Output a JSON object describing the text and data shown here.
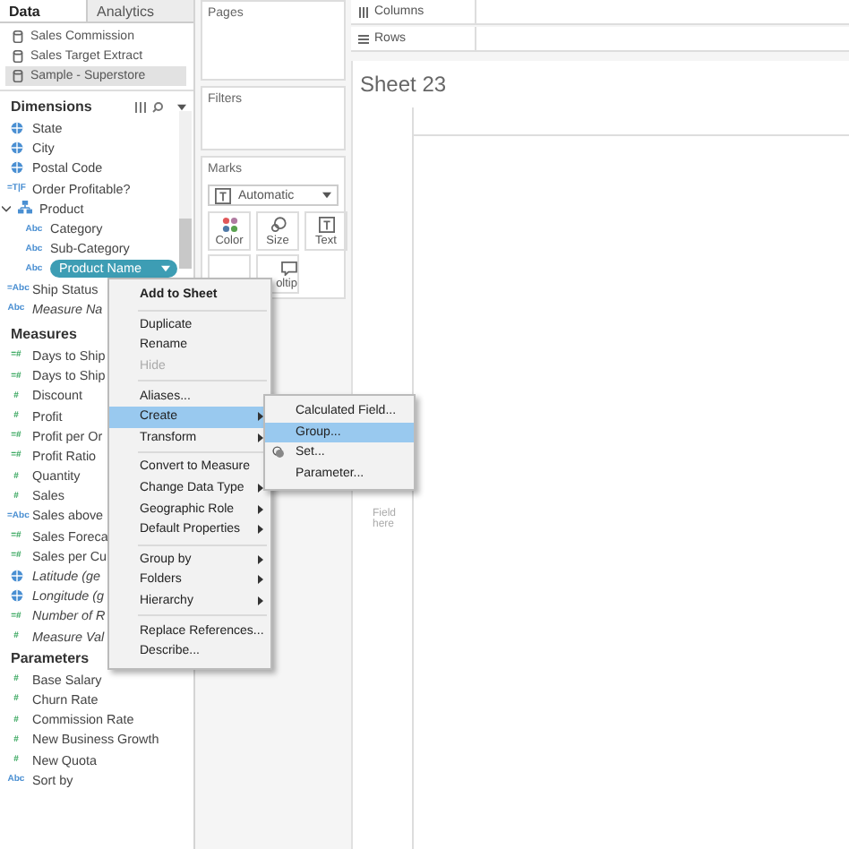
{
  "tabs": [
    {
      "label": "Data",
      "selected": true
    },
    {
      "label": "Analytics",
      "selected": false
    }
  ],
  "data_sources": [
    {
      "label": "Sales Commission",
      "selected": false
    },
    {
      "label": "Sales Target Extract",
      "selected": false
    },
    {
      "label": "Sample - Superstore",
      "selected": true
    }
  ],
  "dimensions": {
    "title": "Dimensions",
    "items": [
      {
        "label": "State",
        "kind": "geo",
        "italic": false,
        "selected": false
      },
      {
        "label": "City",
        "kind": "geo",
        "italic": false,
        "selected": false
      },
      {
        "label": "Postal Code",
        "kind": "geo",
        "italic": false,
        "selected": false
      },
      {
        "label": "Order Profitable?",
        "kind": "dimension",
        "glyph": "=T|F",
        "italic": false,
        "selected": false
      },
      {
        "label": "Product",
        "kind": "hierarchy",
        "italic": false,
        "selected": false,
        "expanded": true,
        "children": [
          {
            "label": "Category",
            "kind": "dimension",
            "glyph": "Abc",
            "italic": false,
            "selected": false
          },
          {
            "label": "Sub-Category",
            "kind": "dimension",
            "glyph": "Abc",
            "italic": false,
            "selected": false
          },
          {
            "label": "Product Name",
            "kind": "dimension",
            "glyph": "Abc",
            "selected": true
          }
        ]
      },
      {
        "label": "Ship Status",
        "kind": "dimension",
        "glyph": "=Abc",
        "italic": false,
        "selected": false
      },
      {
        "label": "Measure Na",
        "kind": "dimension",
        "glyph": "Abc",
        "italic": true,
        "selected": false
      }
    ]
  },
  "measures": {
    "title": "Measures",
    "items": [
      {
        "label": "Days to Ship",
        "kind": "measure",
        "glyph": "=#",
        "italic": false
      },
      {
        "label": "Days to Ship",
        "kind": "measure",
        "glyph": "=#",
        "italic": false
      },
      {
        "label": "Discount",
        "kind": "measure",
        "glyph": "#",
        "italic": false
      },
      {
        "label": "Profit",
        "kind": "measure",
        "glyph": "#",
        "italic": false
      },
      {
        "label": "Profit per Or",
        "kind": "measure",
        "glyph": "=#",
        "italic": false
      },
      {
        "label": "Profit Ratio",
        "kind": "measure",
        "glyph": "=#",
        "italic": false
      },
      {
        "label": "Quantity",
        "kind": "measure",
        "glyph": "#",
        "italic": false
      },
      {
        "label": "Sales",
        "kind": "measure",
        "glyph": "#",
        "italic": false
      },
      {
        "label": "Sales above",
        "kind": "dimension",
        "glyph": "=Abc",
        "italic": false
      },
      {
        "label": "Sales Foreca",
        "kind": "measure",
        "glyph": "=#",
        "italic": false
      },
      {
        "label": "Sales per Cu",
        "kind": "measure",
        "glyph": "=#",
        "italic": false
      },
      {
        "label": "Latitude (ge",
        "kind": "geo",
        "italic": true
      },
      {
        "label": "Longitude (g",
        "kind": "geo",
        "italic": true
      },
      {
        "label": "Number of R",
        "kind": "measure",
        "glyph": "=#",
        "italic": true
      },
      {
        "label": "Measure Val",
        "kind": "measure",
        "glyph": "#",
        "italic": true
      }
    ]
  },
  "parameters": {
    "title": "Parameters",
    "items": [
      {
        "label": "Base Salary",
        "kind": "measure",
        "glyph": "#",
        "italic": false
      },
      {
        "label": "Churn Rate",
        "kind": "measure",
        "glyph": "#",
        "italic": false
      },
      {
        "label": "Commission Rate",
        "kind": "measure",
        "glyph": "#",
        "italic": false
      },
      {
        "label": "New Business Growth",
        "kind": "measure",
        "glyph": "#",
        "italic": false
      },
      {
        "label": "New Quota",
        "kind": "measure",
        "glyph": "#",
        "italic": false
      },
      {
        "label": "Sort by",
        "kind": "dimension",
        "glyph": "Abc",
        "italic": false
      }
    ]
  },
  "shelves": {
    "pages": "Pages",
    "filters": "Filters",
    "columns": "Columns",
    "rows": "Rows"
  },
  "marks": {
    "title": "Marks",
    "mark_type": "Automatic",
    "cards": [
      {
        "label": "Color",
        "kind": "color"
      },
      {
        "label": "Size",
        "kind": "size"
      },
      {
        "label": "Text",
        "kind": "text"
      },
      {
        "kind": "detail"
      },
      {
        "label": "oltip",
        "kind": "tooltip"
      }
    ]
  },
  "sheet": {
    "title": "Sheet 23",
    "drop_hint": "Field here"
  },
  "context_menu": [
    {
      "kind": "item",
      "label": "Add to Sheet",
      "bold": true,
      "disabled": false,
      "selected": false
    },
    {
      "kind": "separator"
    },
    {
      "kind": "item",
      "label": "Duplicate",
      "bold": false,
      "disabled": false,
      "selected": false
    },
    {
      "kind": "item",
      "label": "Rename",
      "bold": false,
      "disabled": false,
      "selected": false
    },
    {
      "kind": "item",
      "label": "Hide",
      "bold": false,
      "disabled": true,
      "selected": false
    },
    {
      "kind": "separator"
    },
    {
      "kind": "item",
      "label": "Aliases...",
      "bold": false,
      "disabled": false,
      "selected": false
    },
    {
      "kind": "item",
      "label": "Create",
      "bold": false,
      "disabled": false,
      "selected": true,
      "submenu": true,
      "expanded": true,
      "children": [
        {
          "kind": "item",
          "label": "Calculated Field...",
          "selected": false
        },
        {
          "kind": "item",
          "label": "Group...",
          "selected": true
        },
        {
          "kind": "set",
          "label": "Set...",
          "selected": false
        },
        {
          "kind": "item",
          "label": "Parameter...",
          "selected": false
        }
      ]
    },
    {
      "kind": "item",
      "label": "Transform",
      "bold": false,
      "disabled": false,
      "selected": false,
      "submenu": true
    },
    {
      "kind": "separator"
    },
    {
      "kind": "item",
      "label": "Convert to Measure",
      "bold": false,
      "disabled": false,
      "selected": false
    },
    {
      "kind": "item",
      "label": "Change Data Type",
      "bold": false,
      "disabled": false,
      "selected": false,
      "submenu": true
    },
    {
      "kind": "item",
      "label": "Geographic Role",
      "bold": false,
      "disabled": false,
      "selected": false,
      "submenu": true
    },
    {
      "kind": "item",
      "label": "Default Properties",
      "bold": false,
      "disabled": false,
      "selected": false,
      "submenu": true
    },
    {
      "kind": "separator"
    },
    {
      "kind": "item",
      "label": "Group by",
      "bold": false,
      "disabled": false,
      "selected": false,
      "submenu": true
    },
    {
      "kind": "item",
      "label": "Folders",
      "bold": false,
      "disabled": false,
      "selected": false,
      "submenu": true
    },
    {
      "kind": "item",
      "label": "Hierarchy",
      "bold": false,
      "disabled": false,
      "selected": false,
      "submenu": true
    },
    {
      "kind": "separator"
    },
    {
      "kind": "item",
      "label": "Replace References...",
      "bold": false,
      "disabled": false,
      "selected": false
    },
    {
      "kind": "item",
      "label": "Describe...",
      "bold": false,
      "disabled": false,
      "selected": false
    }
  ]
}
